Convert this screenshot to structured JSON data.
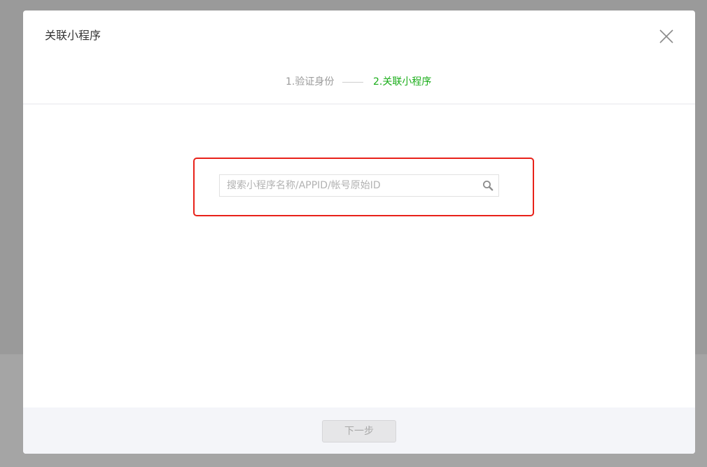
{
  "dialog": {
    "title": "关联小程序",
    "close_icon": "close-icon"
  },
  "steps": [
    {
      "label": "1.验证身份",
      "state": "done"
    },
    {
      "label": "2.关联小程序",
      "state": "active"
    }
  ],
  "search": {
    "value": "",
    "placeholder": "搜索小程序名称/APPID/帐号原始ID",
    "icon": "search-icon"
  },
  "footer": {
    "next_label": "下一步",
    "next_disabled": true
  },
  "colors": {
    "accent_green": "#1aad19",
    "highlight_red": "#e8221a",
    "overlay": "#9a9a9a"
  }
}
